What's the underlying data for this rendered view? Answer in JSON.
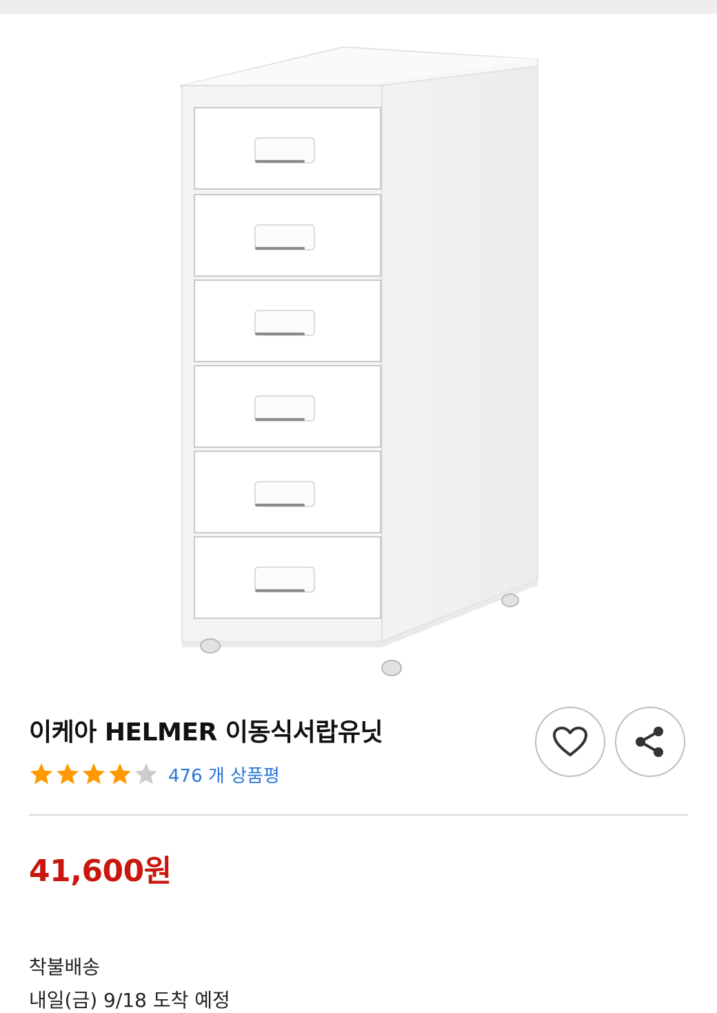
{
  "product": {
    "title": "이케아 HELMER 이동식서랍유닛",
    "rating": 4,
    "rating_max": 5,
    "review_count_text": "476 개 상품평",
    "price": "41,600원",
    "shipping_type": "착불배송",
    "shipping_date": "내일(금) 9/18 도착 예정"
  },
  "icons": {
    "wishlist": "heart-icon",
    "share": "share-icon",
    "star_filled": "star-filled-icon",
    "star_empty": "star-empty-icon"
  },
  "colors": {
    "star": "#ff9900",
    "star_empty": "#cccccc",
    "price": "#c9170f",
    "link": "#2a75d6"
  }
}
